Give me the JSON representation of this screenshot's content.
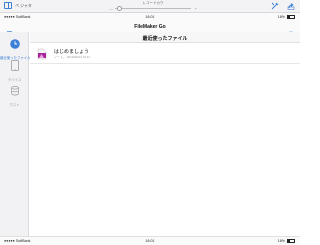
{
  "viewer": {
    "book_label": "ペ ジャタ",
    "slider_label": "レコードカウ",
    "slider_min": "—",
    "slider_max": "+",
    "slider_value": 0.06
  },
  "status_top": {
    "carrier": "●●●●● SoftBank",
    "time": "16:01",
    "battery": "18%"
  },
  "nav": {
    "title": "FileMaker Go"
  },
  "sidebar": {
    "items": [
      {
        "label": "最近使ったファイル",
        "icon": "clock-icon",
        "active": true
      },
      {
        "label": "デバイス",
        "icon": "ipad-icon",
        "active": false
      },
      {
        "label": "ホスト",
        "icon": "database-icon",
        "active": false
      }
    ]
  },
  "main": {
    "title": "最近使ったファイル",
    "files": [
      {
        "name": "はじめましょう",
        "meta": "ノート、 2013/06/14 15:11"
      }
    ]
  },
  "status_bottom": {
    "carrier": "●●●●● SoftBank",
    "time": "16:01",
    "battery": "18%"
  },
  "colors": {
    "accent": "#3b7fd6",
    "file_icon": "#a8249a"
  }
}
